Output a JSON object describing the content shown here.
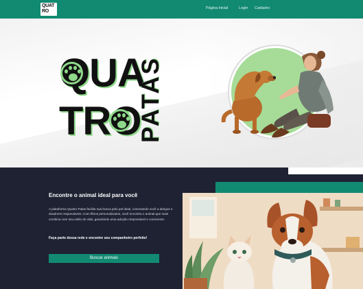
{
  "navbar": {
    "logo": {
      "line1": "QUATRO",
      "line2": ""
    },
    "links": [
      {
        "label": "Página inicial"
      },
      {
        "label": "Login"
      },
      {
        "label": "Cadastro"
      }
    ],
    "colors": {
      "brand": "#128a72"
    }
  },
  "hero": {
    "word_line1": "QUA",
    "word_line2": "TRO",
    "word_vertical": "PATAS",
    "accent_color": "#8ed98a"
  },
  "info": {
    "title": "Encontre o animal ideal para você",
    "text": "A plataforma Quatro Patas facilita sua busca pelo pet ideal, conectando você a abrigos e doadores responsáveis. Com filtros personalizados, você encontra o animal que mais combina com seu estilo de vida, garantindo uma adoção responsável e consciente.",
    "cta": "Faça parte dessa rede e encontre seu companheiro perfeito!",
    "button_label": "Buscar animais",
    "background": "#1e2232"
  }
}
